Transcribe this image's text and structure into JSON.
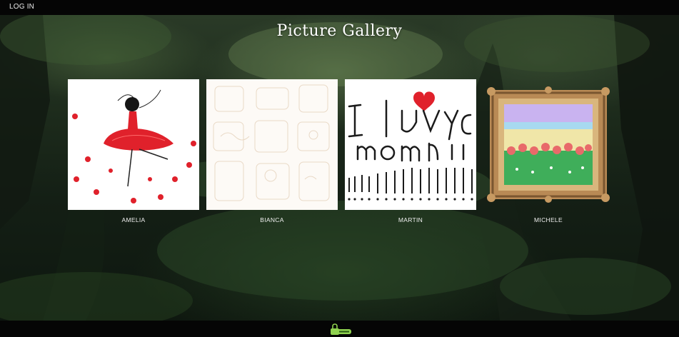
{
  "header": {
    "login_label": "LOG IN"
  },
  "page": {
    "title": "Picture Gallery"
  },
  "gallery": [
    {
      "name": "AMELIA",
      "picture": "red-ballerina-drawing"
    },
    {
      "name": "BIANCA",
      "picture": "faint-doodle-drawing"
    },
    {
      "name": "MARTIN",
      "picture": "i-luv-you-mom-drawing"
    },
    {
      "name": "MICHELE",
      "picture": "framed-flower-painting"
    }
  ],
  "footer": {
    "badge_icon": "lock-badge-icon"
  },
  "colors": {
    "bar": "#050505",
    "text": "#ffffff",
    "accent_red": "#e0212b"
  }
}
